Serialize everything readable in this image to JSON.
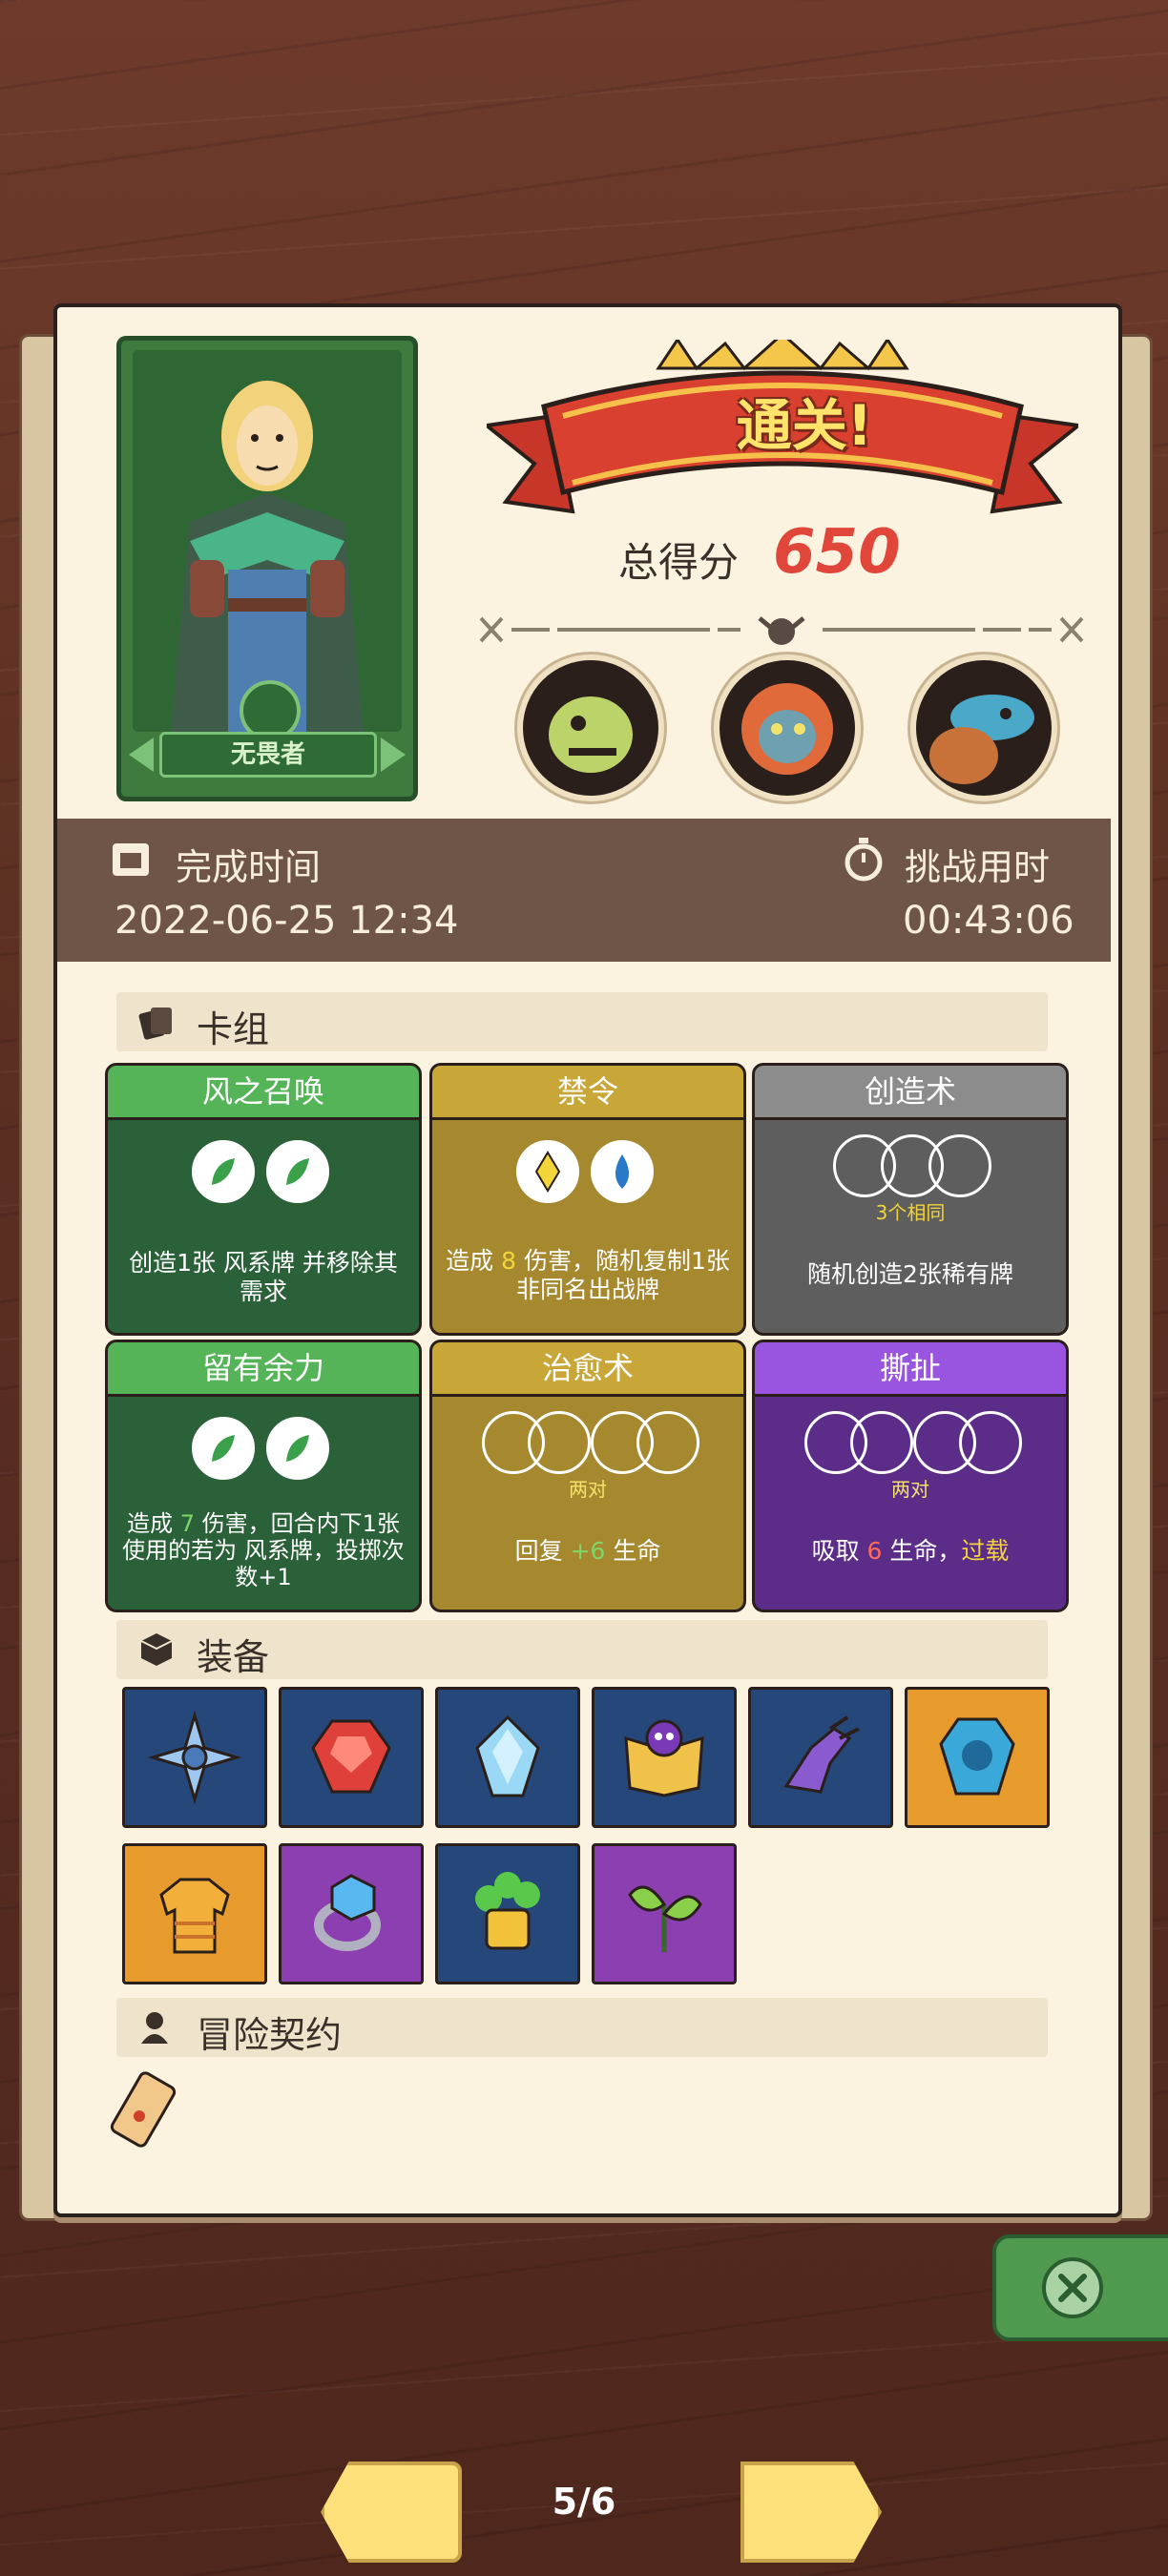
{
  "hero": {
    "name": "无畏者"
  },
  "result": {
    "title": "通关!",
    "score_label": "总得分",
    "score_value": "650"
  },
  "time_bar": {
    "finish_label": "完成时间",
    "finish_value": "2022-06-25 12:34",
    "duration_label": "挑战用时",
    "duration_value": "00:43:06"
  },
  "deck": {
    "title": "卡组",
    "cards": [
      {
        "name": "风之召唤",
        "color": "green",
        "text": "创造1张 风系牌 并移除其需求",
        "sub": ""
      },
      {
        "name": "禁令",
        "color": "gold",
        "text_prefix": "造成 ",
        "dmg": "8",
        "text": " 伤害，随机复制1张非同名出战牌",
        "sub": ""
      },
      {
        "name": "创造术",
        "color": "grey",
        "sub": "3个相同",
        "text": "随机创造2张稀有牌"
      },
      {
        "name": "留有余力",
        "color": "green",
        "text_prefix": "造成 ",
        "dmg": "7",
        "text": " 伤害，回合内下1张使用的若为 风系牌，投掷次数+1",
        "sub": ""
      },
      {
        "name": "治愈术",
        "color": "gold",
        "sub": "两对",
        "text_prefix": "回复 ",
        "heal": "+6",
        "text": " 生命"
      },
      {
        "name": "撕扯",
        "color": "purple",
        "sub": "两对",
        "text_prefix": "吸取 ",
        "drain": "6",
        "text": " 生命，",
        "highlight": "过载"
      }
    ]
  },
  "equipment": {
    "title": "装备",
    "items": [
      {
        "icon": "compass-star-icon",
        "bg": "blue"
      },
      {
        "icon": "red-gem-icon",
        "bg": "blue"
      },
      {
        "icon": "blue-crystal-icon",
        "bg": "blue"
      },
      {
        "icon": "skull-spellbook-icon",
        "bg": "blue"
      },
      {
        "icon": "purple-claw-icon",
        "bg": "blue"
      },
      {
        "icon": "blue-shield-icon",
        "bg": "orange"
      },
      {
        "icon": "orange-tunic-icon",
        "bg": "orange"
      },
      {
        "icon": "diamond-ring-icon",
        "bg": "purple"
      },
      {
        "icon": "gold-tree-icon",
        "bg": "blue"
      },
      {
        "icon": "green-leaves-icon",
        "bg": "purple"
      }
    ]
  },
  "contract": {
    "title": "冒险契约",
    "icon": "scroll-icon"
  },
  "nav": {
    "page": "5/6"
  },
  "colors": {
    "score": "#e0473a",
    "paper": "#fbf3df",
    "timebar": "#6e5547"
  }
}
